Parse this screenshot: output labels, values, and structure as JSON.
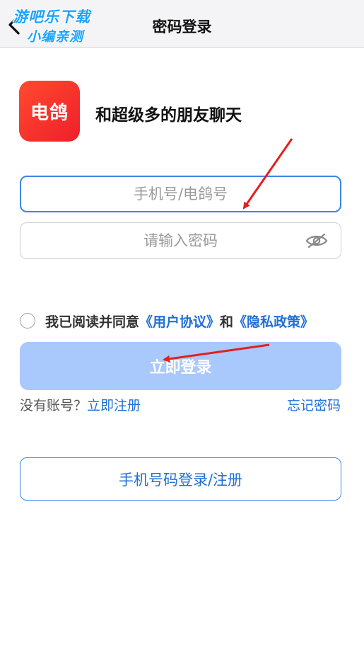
{
  "header": {
    "title": "密码登录",
    "watermark_line1": "游吧乐下载",
    "watermark_line2": "小编亲测"
  },
  "app": {
    "logo_text": "电鸽",
    "slogan": "和超级多的朋友聊天"
  },
  "form": {
    "phone_placeholder": "手机号/电鸽号",
    "password_placeholder": "请输入密码"
  },
  "agreement": {
    "prefix": "我已阅读并同意",
    "user_agreement": "《用户协议》",
    "and": "和",
    "privacy_policy": "《隐私政策》"
  },
  "login_button": "立即登录",
  "register": {
    "prompt": "没有账号？",
    "link": "立即注册"
  },
  "forgot_password": "忘记密码",
  "phone_login_button": "手机号码登录/注册",
  "colors": {
    "brand_red": "#f02b2b",
    "accent_blue": "#1f6fd6",
    "login_disabled": "#a9c8fb",
    "annotation_arrow": "#e21f1f"
  },
  "icons": {
    "back": "chevron-left-icon",
    "eye": "eye-off-icon"
  }
}
